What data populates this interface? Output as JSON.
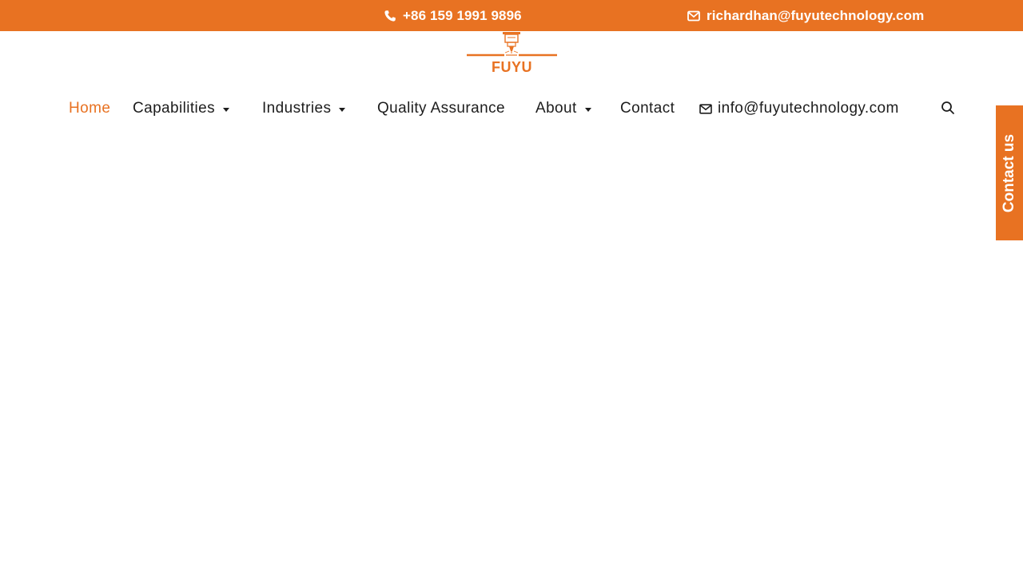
{
  "topbar": {
    "phone": "+86 159 1991 9896",
    "email": "richardhan@fuyutechnology.com",
    "phone_icon": "phone-icon",
    "email_icon": "envelope-icon",
    "background": "#e87222"
  },
  "logo": {
    "text": "FUYU",
    "icon": "cnc-machine-icon",
    "color": "#e87222"
  },
  "nav": {
    "home": "Home",
    "capabilities": "Capabilities",
    "industries": "Industries",
    "quality": "Quality Assurance",
    "about": "About",
    "contact": "Contact",
    "email": "info@fuyutechnology.com",
    "active_color": "#e87222",
    "search_icon": "search-icon"
  },
  "side_tab": {
    "label": "Contact us"
  }
}
